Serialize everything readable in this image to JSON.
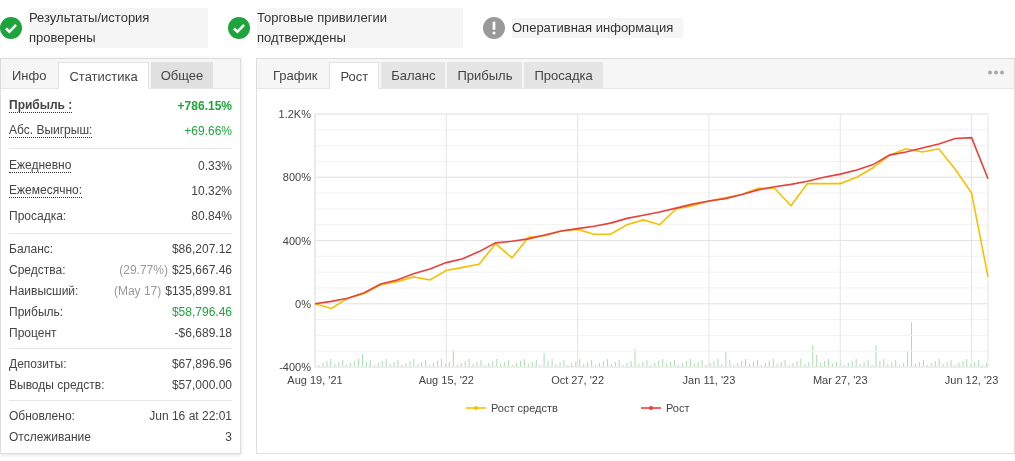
{
  "badges": [
    {
      "kind": "check",
      "text": "Результаты/история проверены"
    },
    {
      "kind": "check",
      "text": "Торговые привилегии подтверждены"
    },
    {
      "kind": "info",
      "text": "Оперативная информация"
    }
  ],
  "stats_panel": {
    "tabs": [
      {
        "label": "Инфо",
        "selected": false
      },
      {
        "label": "Статистика",
        "selected": true
      },
      {
        "label": "Общее",
        "selected": false
      }
    ],
    "groups": [
      [
        {
          "kind": "headline",
          "label": "Прибыль :",
          "dotted": true,
          "value": "+786.15%",
          "color": "#1fa33d"
        },
        {
          "kind": "stat",
          "label": "Абс. Выигрыш:",
          "dotted": true,
          "value": "+69.66%",
          "color": "#1fa33d"
        }
      ],
      [
        {
          "kind": "stat",
          "label": "Ежедневно",
          "dotted": true,
          "value": "0.33%",
          "color": "#444444"
        },
        {
          "kind": "stat",
          "label": "Ежемесячно:",
          "dotted": true,
          "value": "10.32%",
          "color": "#444444"
        },
        {
          "kind": "stat",
          "label": "Просадка:",
          "dotted": false,
          "value": "80.84%",
          "color": "#444444"
        }
      ],
      [
        {
          "kind": "stat",
          "label": "Баланс:",
          "dotted": false,
          "value": "$86,207.12",
          "color": "#444444"
        },
        {
          "kind": "stat",
          "label": "Средства:",
          "dotted": false,
          "note": "(29.77%)",
          "value": "$25,667.46",
          "color": "#444444"
        },
        {
          "kind": "stat",
          "label": "Наивысший:",
          "dotted": false,
          "note": "(May 17)",
          "value": "$135,899.81",
          "color": "#444444"
        },
        {
          "kind": "stat",
          "label": "Прибыль:",
          "dotted": false,
          "value": "$58,796.46",
          "color": "#1fa33d"
        },
        {
          "kind": "stat",
          "label": "Процент",
          "dotted": false,
          "value": "-$6,689.18",
          "color": "#444444"
        }
      ],
      [
        {
          "kind": "stat",
          "label": "Депозиты:",
          "dotted": false,
          "value": "$67,896.96",
          "color": "#444444"
        },
        {
          "kind": "stat",
          "label": "Выводы средств:",
          "dotted": false,
          "value": "$57,000.00",
          "color": "#444444"
        }
      ],
      [
        {
          "kind": "stat",
          "label": "Обновлено:",
          "dotted": false,
          "value": "Jun 16 at 22:01",
          "color": "#444444"
        },
        {
          "kind": "stat",
          "label": "Отслеживание",
          "dotted": false,
          "value": "3",
          "color": "#444444"
        }
      ]
    ]
  },
  "chart_panel": {
    "tabs": [
      {
        "label": "График",
        "selected": false
      },
      {
        "label": "Рост",
        "selected": true
      },
      {
        "label": "Баланс",
        "selected": false
      },
      {
        "label": "Прибыль",
        "selected": false
      },
      {
        "label": "Просадка",
        "selected": false
      }
    ],
    "chart_data": {
      "type": "line",
      "grid": true,
      "legend": true,
      "categories": [
        "Aug 19, '21",
        null,
        null,
        null,
        null,
        null,
        null,
        null,
        "Aug 15, '22",
        null,
        null,
        null,
        null,
        null,
        null,
        null,
        "Oct 27, '22",
        null,
        null,
        null,
        null,
        null,
        null,
        null,
        "Jan 11, '23",
        null,
        null,
        null,
        null,
        null,
        null,
        null,
        "Mar 27, '23",
        null,
        null,
        null,
        null,
        null,
        null,
        null,
        "Jun 12, '23",
        null
      ],
      "ylim": [
        -400,
        1200
      ],
      "yticks": [
        {
          "value": -400,
          "label": "-400%"
        },
        {
          "value": 0,
          "label": "0%"
        },
        {
          "value": 400,
          "label": "400%"
        },
        {
          "value": 800,
          "label": "800%"
        },
        {
          "value": 1200,
          "label": "1.2K%"
        }
      ],
      "series": [
        {
          "name": "Рост средств",
          "color": "#f5c000",
          "values": [
            0,
            -30,
            35,
            65,
            120,
            140,
            170,
            150,
            210,
            230,
            250,
            380,
            290,
            420,
            430,
            460,
            470,
            440,
            440,
            500,
            530,
            500,
            600,
            620,
            650,
            670,
            690,
            730,
            730,
            620,
            760,
            760,
            760,
            800,
            860,
            940,
            980,
            960,
            980,
            850,
            700,
            170
          ]
        },
        {
          "name": "Рост",
          "color": "#e8403a",
          "values": [
            0,
            15,
            35,
            70,
            125,
            150,
            190,
            220,
            260,
            285,
            330,
            385,
            395,
            410,
            435,
            460,
            475,
            490,
            510,
            540,
            560,
            580,
            605,
            630,
            650,
            665,
            690,
            720,
            740,
            755,
            775,
            800,
            820,
            845,
            880,
            940,
            960,
            985,
            1010,
            1045,
            1050,
            790
          ]
        }
      ]
    }
  }
}
